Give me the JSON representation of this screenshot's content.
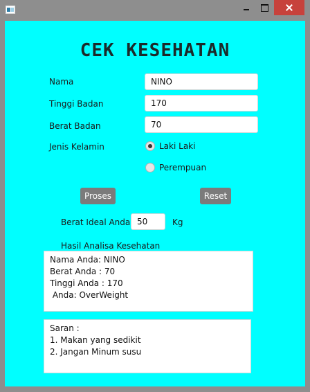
{
  "window": {
    "icon": "java-app-icon"
  },
  "form": {
    "title": "CEK KESEHATAN",
    "nama_label": "Nama",
    "nama_value": "NINO",
    "tinggi_label": "Tinggi Badan",
    "tinggi_value": "170",
    "berat_label": "Berat Badan",
    "berat_value": "70",
    "jenis_label": "Jenis Kelamin",
    "gender_options": [
      "Laki Laki",
      "Perempuan"
    ],
    "gender_selected": "Laki Laki",
    "proses_label": "Proses",
    "reset_label": "Reset",
    "ideal_label": "Berat Ideal Anda",
    "ideal_value": "50",
    "ideal_unit": "Kg",
    "analisa_label": "Hasil Analisa Kesehatan",
    "analisa_lines": [
      "Nama Anda: NINO",
      "Berat Anda : 70",
      "Tinggi Anda : 170",
      " Anda: OverWeight"
    ],
    "saran_lines": [
      "Saran :",
      "1. Makan yang sedikit",
      "2. Jangan Minum susu"
    ]
  }
}
